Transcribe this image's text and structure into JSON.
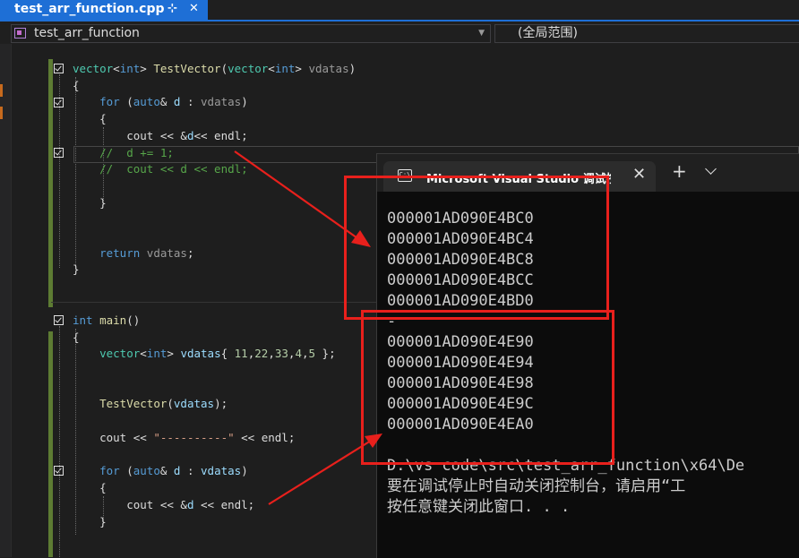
{
  "tab": {
    "title": "test_arr_function.cpp",
    "pin_icon": "pin-icon",
    "close_icon": "close-icon"
  },
  "navigation": {
    "scope_combo": "test_arr_function",
    "member_combo": "(全局范围)"
  },
  "code": {
    "lines": [
      "vector<int> TestVector(vector<int> vdatas)",
      "{",
      "for (auto& d : vdatas)",
      "{",
      "cout << &d<< endl;",
      "//  d += 1;",
      "//  cout << d << endl;",
      "}",
      "return vdatas;",
      "}",
      "int main()",
      "{",
      "vector<int> vdatas{ 11,22,33,4,5 };",
      "TestVector(vdatas);",
      "cout << \"----------\" << endl;",
      "for (auto& d : vdatas)",
      "{",
      "cout << &d << endl;",
      "}"
    ]
  },
  "console": {
    "title": "Microsoft Visual Studio 调试控制台",
    "first_block": [
      "000001AD090E4BC0",
      "000001AD090E4BC4",
      "000001AD090E4BC8",
      "000001AD090E4BCC",
      "000001AD090E4BD0"
    ],
    "second_block": [
      "000001AD090E4E90",
      "000001AD090E4E94",
      "000001AD090E4E98",
      "000001AD090E4E9C",
      "000001AD090E4EA0"
    ],
    "footer": [
      "D:\\vs code\\src\\test_arr_function\\x64\\De",
      "要在调试停止时自动关闭控制台，请启用“工",
      "按任意键关闭此窗口. . ."
    ]
  },
  "colors": {
    "tab_accent": "#1e6fd6",
    "annotation_red": "#e8201c",
    "change_bar": "#5d7c33"
  }
}
